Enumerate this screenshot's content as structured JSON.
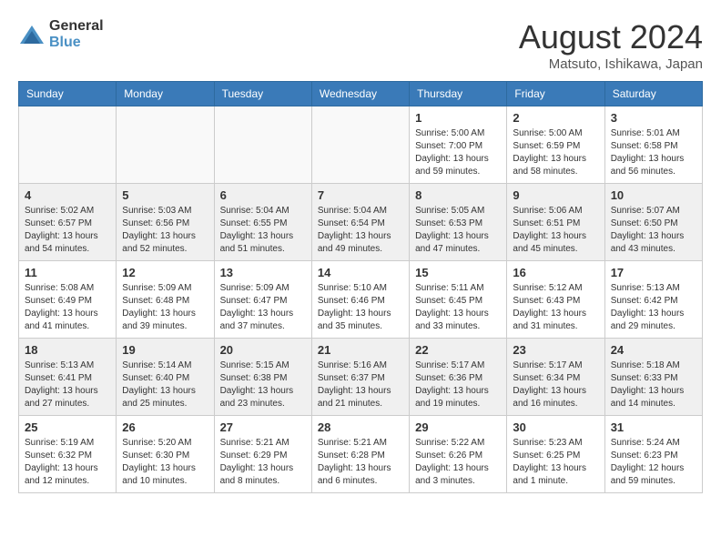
{
  "header": {
    "logo_general": "General",
    "logo_blue": "Blue",
    "month_year": "August 2024",
    "location": "Matsuto, Ishikawa, Japan"
  },
  "weekdays": [
    "Sunday",
    "Monday",
    "Tuesday",
    "Wednesday",
    "Thursday",
    "Friday",
    "Saturday"
  ],
  "weeks": [
    {
      "days": [
        {
          "num": "",
          "info": "",
          "empty": true
        },
        {
          "num": "",
          "info": "",
          "empty": true
        },
        {
          "num": "",
          "info": "",
          "empty": true
        },
        {
          "num": "",
          "info": "",
          "empty": true
        },
        {
          "num": "1",
          "info": "Sunrise: 5:00 AM\nSunset: 7:00 PM\nDaylight: 13 hours\nand 59 minutes."
        },
        {
          "num": "2",
          "info": "Sunrise: 5:00 AM\nSunset: 6:59 PM\nDaylight: 13 hours\nand 58 minutes."
        },
        {
          "num": "3",
          "info": "Sunrise: 5:01 AM\nSunset: 6:58 PM\nDaylight: 13 hours\nand 56 minutes."
        }
      ]
    },
    {
      "days": [
        {
          "num": "4",
          "info": "Sunrise: 5:02 AM\nSunset: 6:57 PM\nDaylight: 13 hours\nand 54 minutes."
        },
        {
          "num": "5",
          "info": "Sunrise: 5:03 AM\nSunset: 6:56 PM\nDaylight: 13 hours\nand 52 minutes."
        },
        {
          "num": "6",
          "info": "Sunrise: 5:04 AM\nSunset: 6:55 PM\nDaylight: 13 hours\nand 51 minutes."
        },
        {
          "num": "7",
          "info": "Sunrise: 5:04 AM\nSunset: 6:54 PM\nDaylight: 13 hours\nand 49 minutes."
        },
        {
          "num": "8",
          "info": "Sunrise: 5:05 AM\nSunset: 6:53 PM\nDaylight: 13 hours\nand 47 minutes."
        },
        {
          "num": "9",
          "info": "Sunrise: 5:06 AM\nSunset: 6:51 PM\nDaylight: 13 hours\nand 45 minutes."
        },
        {
          "num": "10",
          "info": "Sunrise: 5:07 AM\nSunset: 6:50 PM\nDaylight: 13 hours\nand 43 minutes."
        }
      ]
    },
    {
      "days": [
        {
          "num": "11",
          "info": "Sunrise: 5:08 AM\nSunset: 6:49 PM\nDaylight: 13 hours\nand 41 minutes."
        },
        {
          "num": "12",
          "info": "Sunrise: 5:09 AM\nSunset: 6:48 PM\nDaylight: 13 hours\nand 39 minutes."
        },
        {
          "num": "13",
          "info": "Sunrise: 5:09 AM\nSunset: 6:47 PM\nDaylight: 13 hours\nand 37 minutes."
        },
        {
          "num": "14",
          "info": "Sunrise: 5:10 AM\nSunset: 6:46 PM\nDaylight: 13 hours\nand 35 minutes."
        },
        {
          "num": "15",
          "info": "Sunrise: 5:11 AM\nSunset: 6:45 PM\nDaylight: 13 hours\nand 33 minutes."
        },
        {
          "num": "16",
          "info": "Sunrise: 5:12 AM\nSunset: 6:43 PM\nDaylight: 13 hours\nand 31 minutes."
        },
        {
          "num": "17",
          "info": "Sunrise: 5:13 AM\nSunset: 6:42 PM\nDaylight: 13 hours\nand 29 minutes."
        }
      ]
    },
    {
      "days": [
        {
          "num": "18",
          "info": "Sunrise: 5:13 AM\nSunset: 6:41 PM\nDaylight: 13 hours\nand 27 minutes."
        },
        {
          "num": "19",
          "info": "Sunrise: 5:14 AM\nSunset: 6:40 PM\nDaylight: 13 hours\nand 25 minutes."
        },
        {
          "num": "20",
          "info": "Sunrise: 5:15 AM\nSunset: 6:38 PM\nDaylight: 13 hours\nand 23 minutes."
        },
        {
          "num": "21",
          "info": "Sunrise: 5:16 AM\nSunset: 6:37 PM\nDaylight: 13 hours\nand 21 minutes."
        },
        {
          "num": "22",
          "info": "Sunrise: 5:17 AM\nSunset: 6:36 PM\nDaylight: 13 hours\nand 19 minutes."
        },
        {
          "num": "23",
          "info": "Sunrise: 5:17 AM\nSunset: 6:34 PM\nDaylight: 13 hours\nand 16 minutes."
        },
        {
          "num": "24",
          "info": "Sunrise: 5:18 AM\nSunset: 6:33 PM\nDaylight: 13 hours\nand 14 minutes."
        }
      ]
    },
    {
      "days": [
        {
          "num": "25",
          "info": "Sunrise: 5:19 AM\nSunset: 6:32 PM\nDaylight: 13 hours\nand 12 minutes."
        },
        {
          "num": "26",
          "info": "Sunrise: 5:20 AM\nSunset: 6:30 PM\nDaylight: 13 hours\nand 10 minutes."
        },
        {
          "num": "27",
          "info": "Sunrise: 5:21 AM\nSunset: 6:29 PM\nDaylight: 13 hours\nand 8 minutes."
        },
        {
          "num": "28",
          "info": "Sunrise: 5:21 AM\nSunset: 6:28 PM\nDaylight: 13 hours\nand 6 minutes."
        },
        {
          "num": "29",
          "info": "Sunrise: 5:22 AM\nSunset: 6:26 PM\nDaylight: 13 hours\nand 3 minutes."
        },
        {
          "num": "30",
          "info": "Sunrise: 5:23 AM\nSunset: 6:25 PM\nDaylight: 13 hours\nand 1 minute."
        },
        {
          "num": "31",
          "info": "Sunrise: 5:24 AM\nSunset: 6:23 PM\nDaylight: 12 hours\nand 59 minutes."
        }
      ]
    }
  ]
}
